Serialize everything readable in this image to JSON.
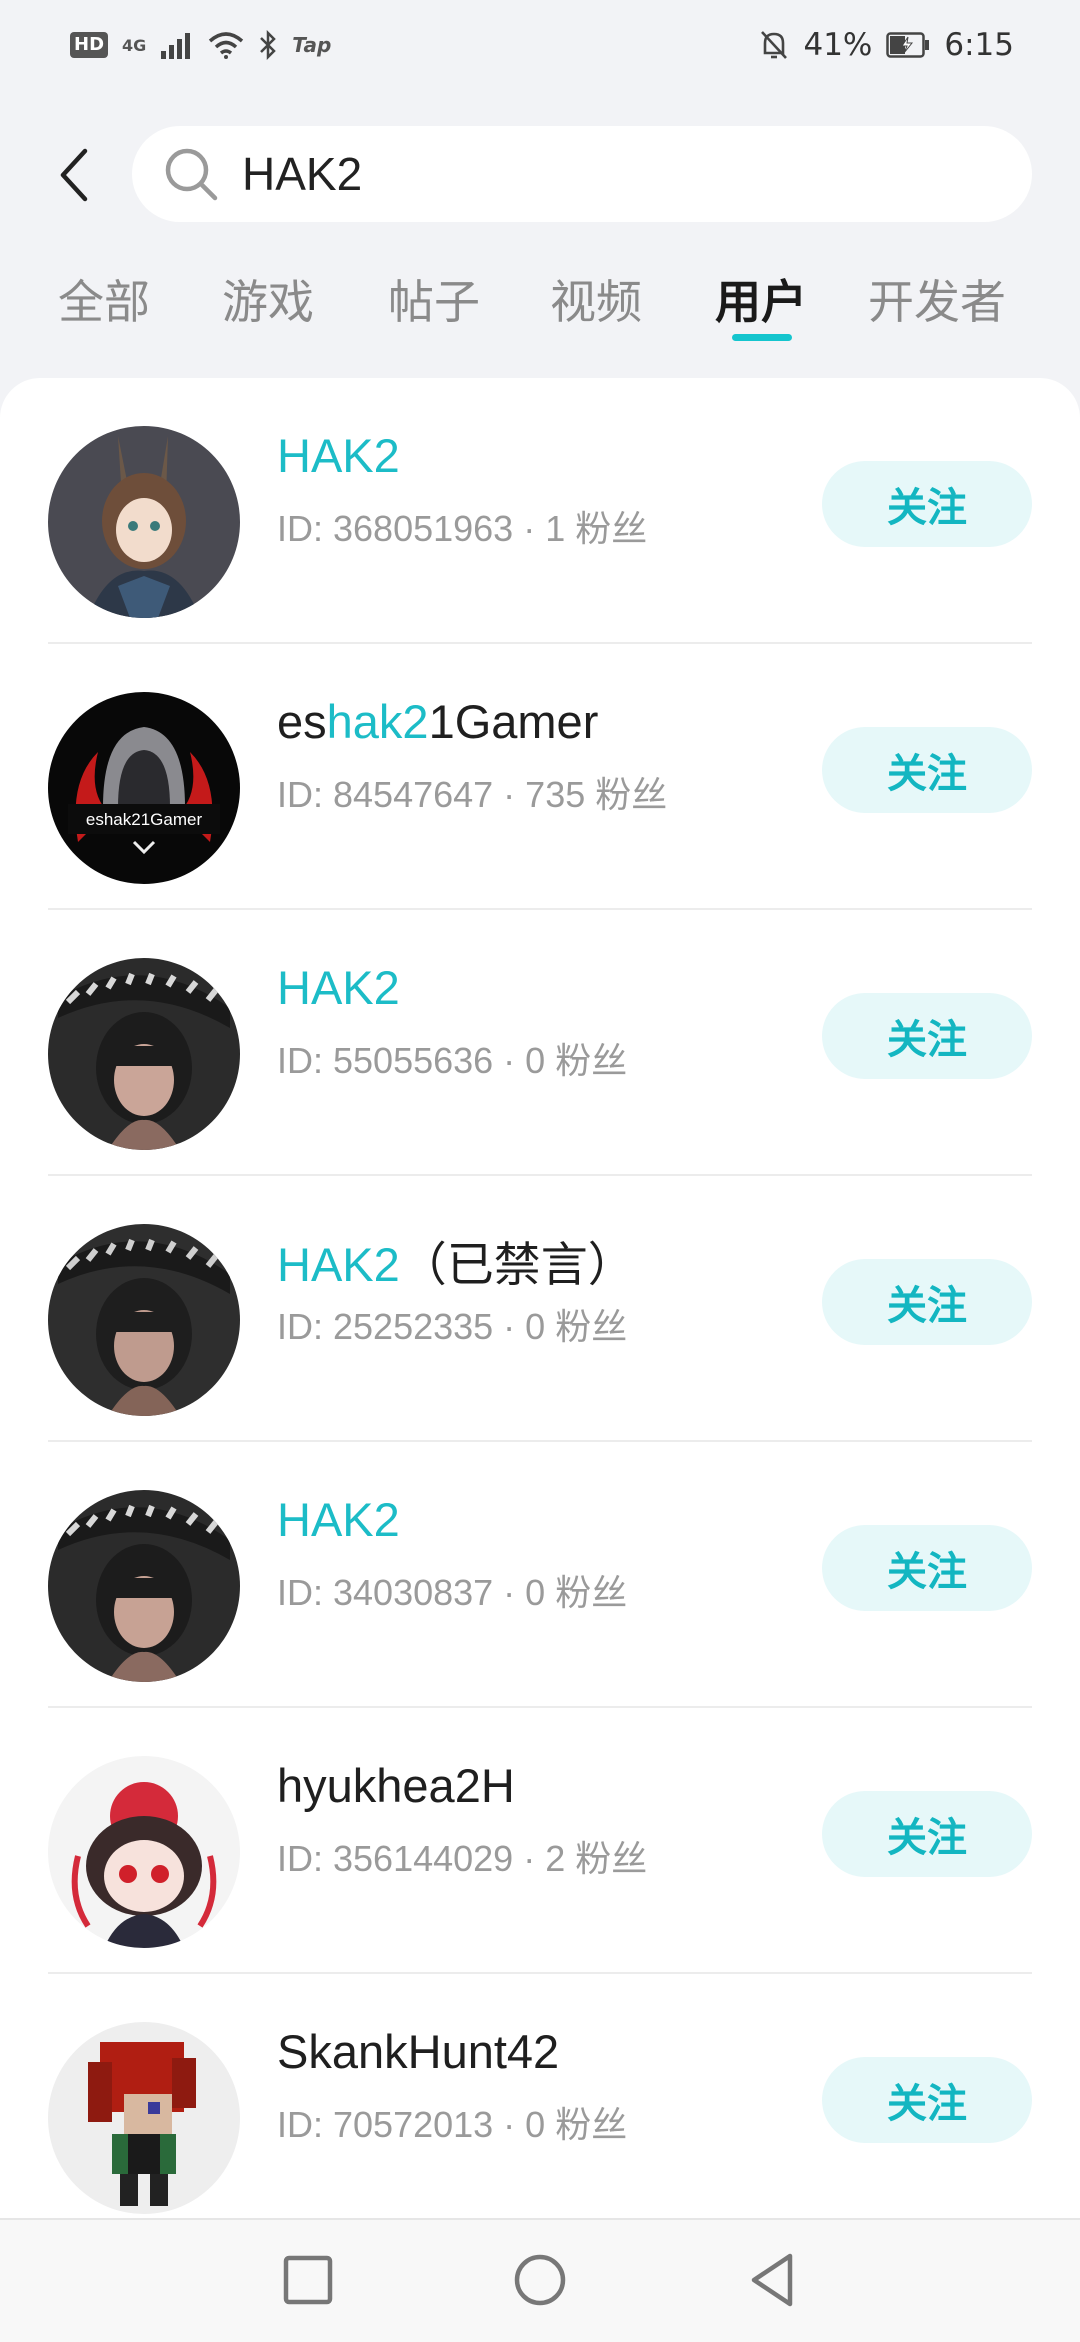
{
  "status_bar": {
    "hd": "HD",
    "network": "4G",
    "app_badge": "Tap",
    "battery_percent": "41%",
    "time": "6:15"
  },
  "search": {
    "value": "HAK2"
  },
  "tabs": [
    {
      "label": "全部",
      "active": false
    },
    {
      "label": "游戏",
      "active": false
    },
    {
      "label": "帖子",
      "active": false
    },
    {
      "label": "视频",
      "active": false
    },
    {
      "label": "用户",
      "active": true
    },
    {
      "label": "开发者",
      "active": false
    }
  ],
  "users": [
    {
      "name_pre": "",
      "name_hl": "HAK2",
      "name_post": "",
      "meta": "ID: 368051963 · 1 粉丝",
      "follow_label": "关注"
    },
    {
      "name_pre": "es",
      "name_hl": "hak2",
      "name_post": "1Gamer",
      "meta": "ID: 84547647 · 735 粉丝",
      "follow_label": "关注",
      "avatar_text": "eshak21Gamer"
    },
    {
      "name_pre": "",
      "name_hl": "HAK2",
      "name_post": "",
      "meta": "ID: 55055636 · 0 粉丝",
      "follow_label": "关注"
    },
    {
      "name_pre": "",
      "name_hl": "HAK2",
      "name_post": "（已禁言）",
      "meta": "ID: 25252335 · 0 粉丝",
      "follow_label": "关注"
    },
    {
      "name_pre": "",
      "name_hl": "HAK2",
      "name_post": "",
      "meta": "ID: 34030837 · 0 粉丝",
      "follow_label": "关注"
    },
    {
      "name_pre": "hyukhea2H",
      "name_hl": "",
      "name_post": "",
      "meta": "ID: 356144029 · 2 粉丝",
      "follow_label": "关注"
    },
    {
      "name_pre": "SkankHunt42",
      "name_hl": "",
      "name_post": "",
      "meta": "ID: 70572013 · 0 粉丝",
      "follow_label": "关注"
    }
  ],
  "colors": {
    "accent": "#1cbcc7",
    "follow_bg": "#e6f8f9",
    "page_bg": "#f2f3f6"
  }
}
